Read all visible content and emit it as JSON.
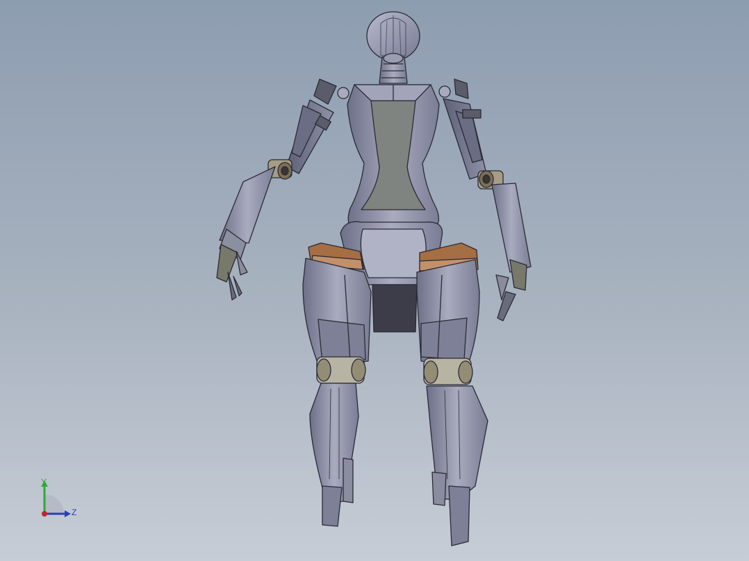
{
  "viewport": {
    "background_top": "#8d9db0",
    "background_bottom": "#c7cdd6"
  },
  "model": {
    "description_icon": "robot-model",
    "body_color": "#8f92a8",
    "accent_color": "#b9875a"
  },
  "triad": {
    "y_label": "Y",
    "z_label": "Z",
    "y_color": "#2fa83c",
    "z_color": "#2b3fb5",
    "x_color": "#c0262a"
  }
}
